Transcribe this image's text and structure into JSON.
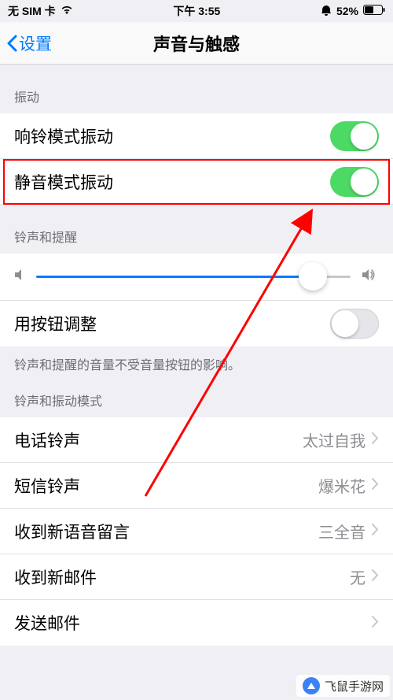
{
  "status_bar": {
    "carrier": "无 SIM 卡",
    "time": "下午 3:55",
    "battery": "52%"
  },
  "nav": {
    "back": "设置",
    "title": "声音与触感"
  },
  "sections": {
    "vibration": {
      "header": "振动",
      "items": [
        {
          "label": "响铃模式振动",
          "toggle": true
        },
        {
          "label": "静音模式振动",
          "toggle": true
        }
      ]
    },
    "ringer": {
      "header": "铃声和提醒",
      "slider_value": 88,
      "button_adjust_label": "用按钮调整",
      "button_adjust_toggle": false,
      "footer": "铃声和提醒的音量不受音量按钮的影响。"
    },
    "patterns": {
      "header": "铃声和振动模式",
      "items": [
        {
          "label": "电话铃声",
          "value": "太过自我"
        },
        {
          "label": "短信铃声",
          "value": "爆米花"
        },
        {
          "label": "收到新语音留言",
          "value": "三全音"
        },
        {
          "label": "收到新邮件",
          "value": "无"
        },
        {
          "label": "发送邮件",
          "value": ""
        }
      ]
    }
  },
  "watermark": {
    "text": "飞鼠手游网"
  },
  "colors": {
    "ios_blue": "#007aff",
    "ios_green": "#4cd964",
    "red_highlight": "#ff0000"
  }
}
